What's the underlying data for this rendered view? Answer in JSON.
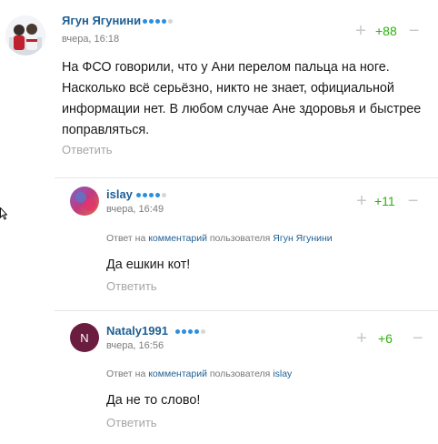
{
  "comments": [
    {
      "author": "Ягун Ягунини",
      "date": "вчера, 16:18",
      "score": "+88",
      "plus": "+",
      "minus": "−",
      "text": "На ФСО говорили, что у Ани перелом пальца на ноге. Насколько всё серьёзно, никто не знает, официальной информации нет. В любом случае Ане здоровья и быстрее поправляться.",
      "reply_label": "Ответить"
    },
    {
      "author": "islay",
      "date": "вчера, 16:49",
      "score": "+11",
      "plus": "+",
      "minus": "−",
      "reply_prefix": "Ответ на",
      "reply_link": "комментарий",
      "reply_mid": "пользователя",
      "reply_user": "Ягун Ягунини",
      "text": "Да ешкин кот!",
      "reply_label": "Ответить"
    },
    {
      "author": "Nataly1991",
      "date": "вчера, 16:56",
      "score": "+6",
      "plus": "+",
      "minus": "−",
      "avatar_letter": "N",
      "reply_prefix": "Ответ на",
      "reply_link": "комментарий",
      "reply_mid": "пользователя",
      "reply_user": "islay",
      "text": "Да не то слово!",
      "reply_label": "Ответить"
    }
  ],
  "colors": {
    "name": "#1f5f94",
    "score": "#2bb20c",
    "rank_dot": "#2b8fe0",
    "rank_dot_off": "#d6d6d6",
    "nataly_avatar": "#6b1d3f"
  }
}
